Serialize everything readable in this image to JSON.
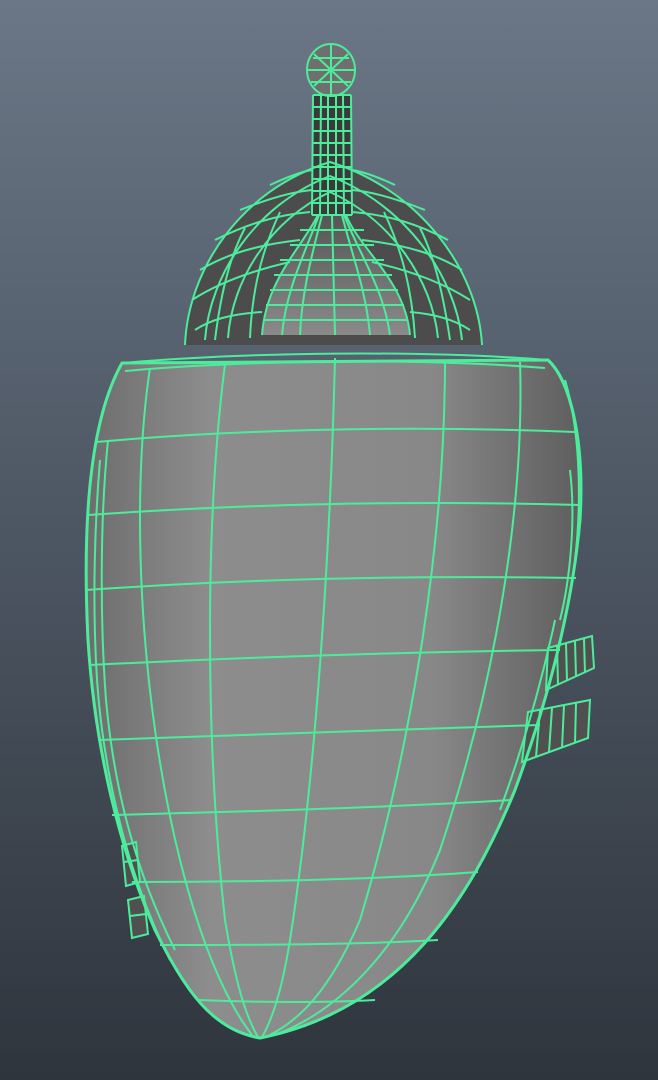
{
  "viewport": {
    "background_top": "#6b7786",
    "background_bottom": "#2f353d"
  },
  "mesh": {
    "selected": true,
    "wireframe_color": "#4dec9c",
    "shaded_color": "#8a8a8a",
    "display": "wireframe-on-shaded"
  }
}
